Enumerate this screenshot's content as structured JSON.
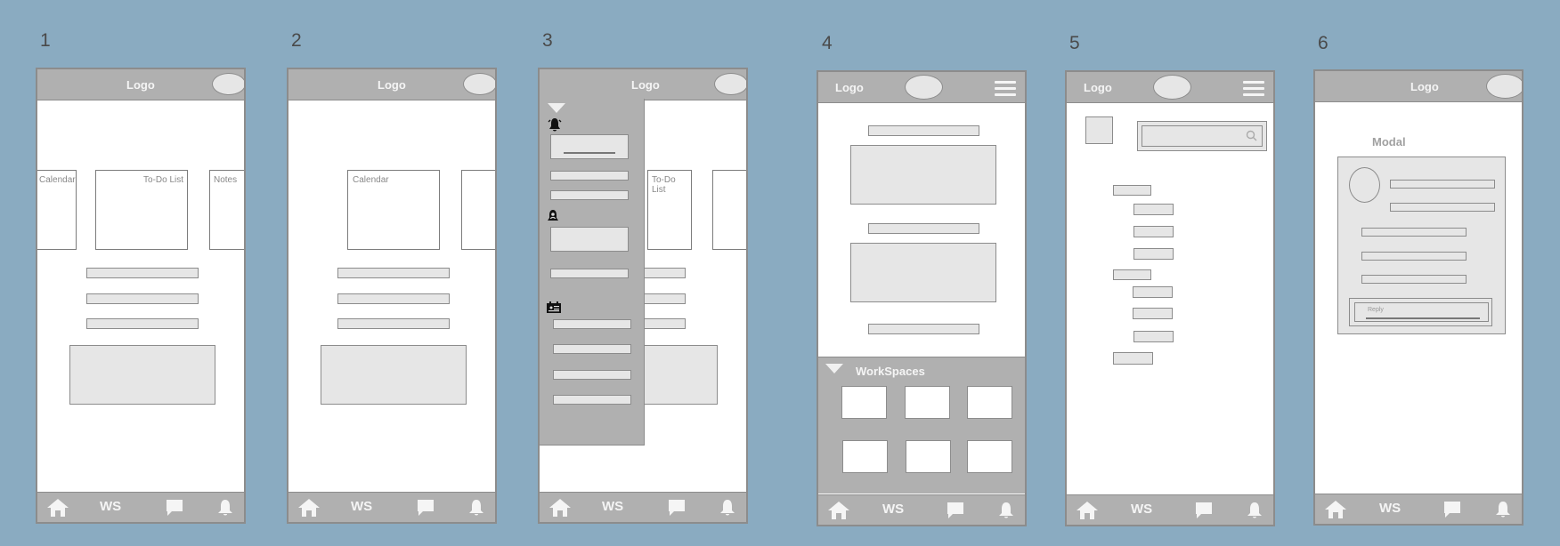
{
  "common": {
    "logo": "Logo",
    "nav": {
      "home_icon": "home-icon",
      "ws_label": "WS",
      "chat_icon": "chat-icon",
      "bell_icon": "bell-icon"
    }
  },
  "frames": [
    {
      "number": "1",
      "cards": [
        "Calendar",
        "To-Do List",
        "Notes"
      ]
    },
    {
      "number": "2",
      "cards": [
        "Calendar"
      ]
    },
    {
      "number": "3",
      "cards": [
        "To-Do List"
      ],
      "drawer_icons": [
        "bell-alert-icon",
        "user-alert-icon",
        "calendar-badge-icon"
      ]
    },
    {
      "number": "4",
      "workspaces_title": "WorkSpaces"
    },
    {
      "number": "5",
      "search_icon": "search-icon"
    },
    {
      "number": "6",
      "modal_label": "Modal",
      "reply_label": "Reply"
    }
  ],
  "colors": {
    "background": "#8aabc1",
    "bar": "#b0b0b0",
    "placeholder": "#e6e6e6",
    "border": "#8c8c8c"
  }
}
